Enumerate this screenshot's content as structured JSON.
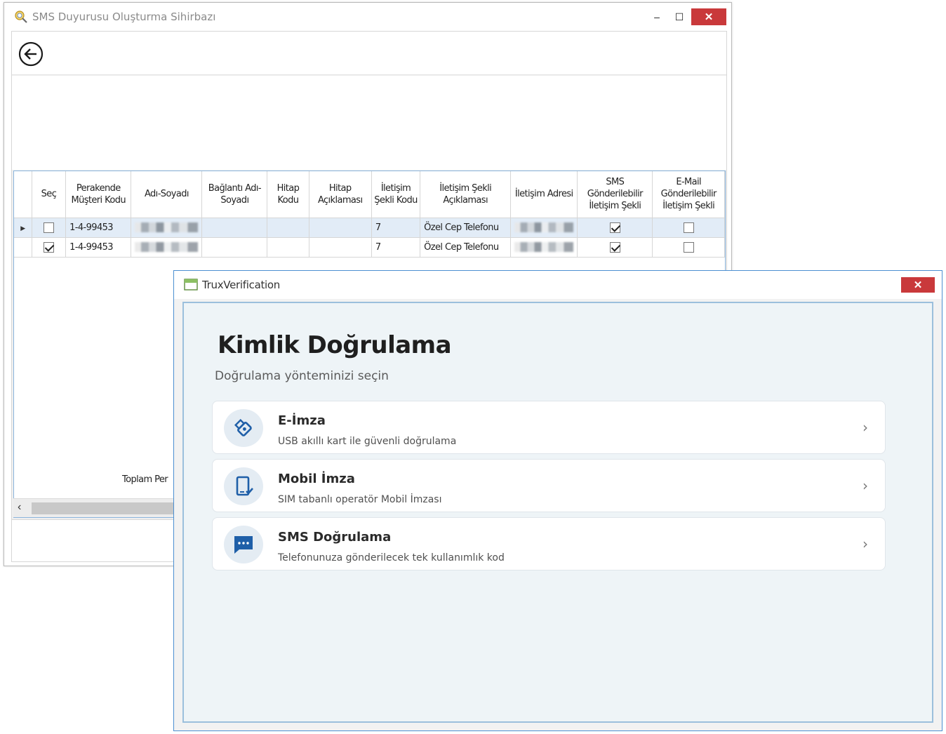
{
  "back_window": {
    "title": "SMS Duyurusu Oluşturma Sihirbazı",
    "minimize_label": "–",
    "maximize_label": "☐",
    "close_label": "✕",
    "grid": {
      "columns": [
        "Seç",
        "Perakende Müşteri Kodu",
        "Adı-Soyadı",
        "Bağlantı Adı-Soyadı",
        "Hitap Kodu",
        "Hitap Açıklaması",
        "İletişim Şekli Kodu",
        "İletişim Şekli Açıklaması",
        "İletişim Adresi",
        "SMS Gönderilebilir İletişim Şekli",
        "E-Mail Gönderilebilir İletişim Şekli"
      ],
      "rows": [
        {
          "sec": false,
          "kod": "1-4-99453",
          "iletisim_sekli_kodu": "7",
          "iletisim_sekli_aciklamasi": "Özel Cep Telefonu",
          "sms": true,
          "email": false
        },
        {
          "sec": true,
          "kod": "1-4-99453",
          "iletisim_sekli_kodu": "7",
          "iletisim_sekli_aciklamasi": "Özel Cep Telefonu",
          "sms": true,
          "email": false
        }
      ]
    },
    "total_label": "Toplam Per"
  },
  "dialog": {
    "title": "TruxVerification",
    "close_label": "✕",
    "heading": "Kimlik Doğrulama",
    "subheading": "Doğrulama yönteminizi seçin",
    "options": [
      {
        "label": "E-İmza",
        "description": "USB akıllı kart ile güvenli doğrulama",
        "icon": "usb-key-icon"
      },
      {
        "label": "Mobil İmza",
        "description": "SIM tabanlı operatör Mobil İmzası",
        "icon": "mobile-signature-icon"
      },
      {
        "label": "SMS Doğrulama",
        "description": "Telefonunuza gönderilecek tek kullanımlık kod",
        "icon": "sms-chat-icon"
      }
    ],
    "chevron": "›"
  },
  "colors": {
    "accent_blue": "#1f5fa8",
    "close_red": "#c9393b",
    "selection_row": "#e2ecf7"
  }
}
